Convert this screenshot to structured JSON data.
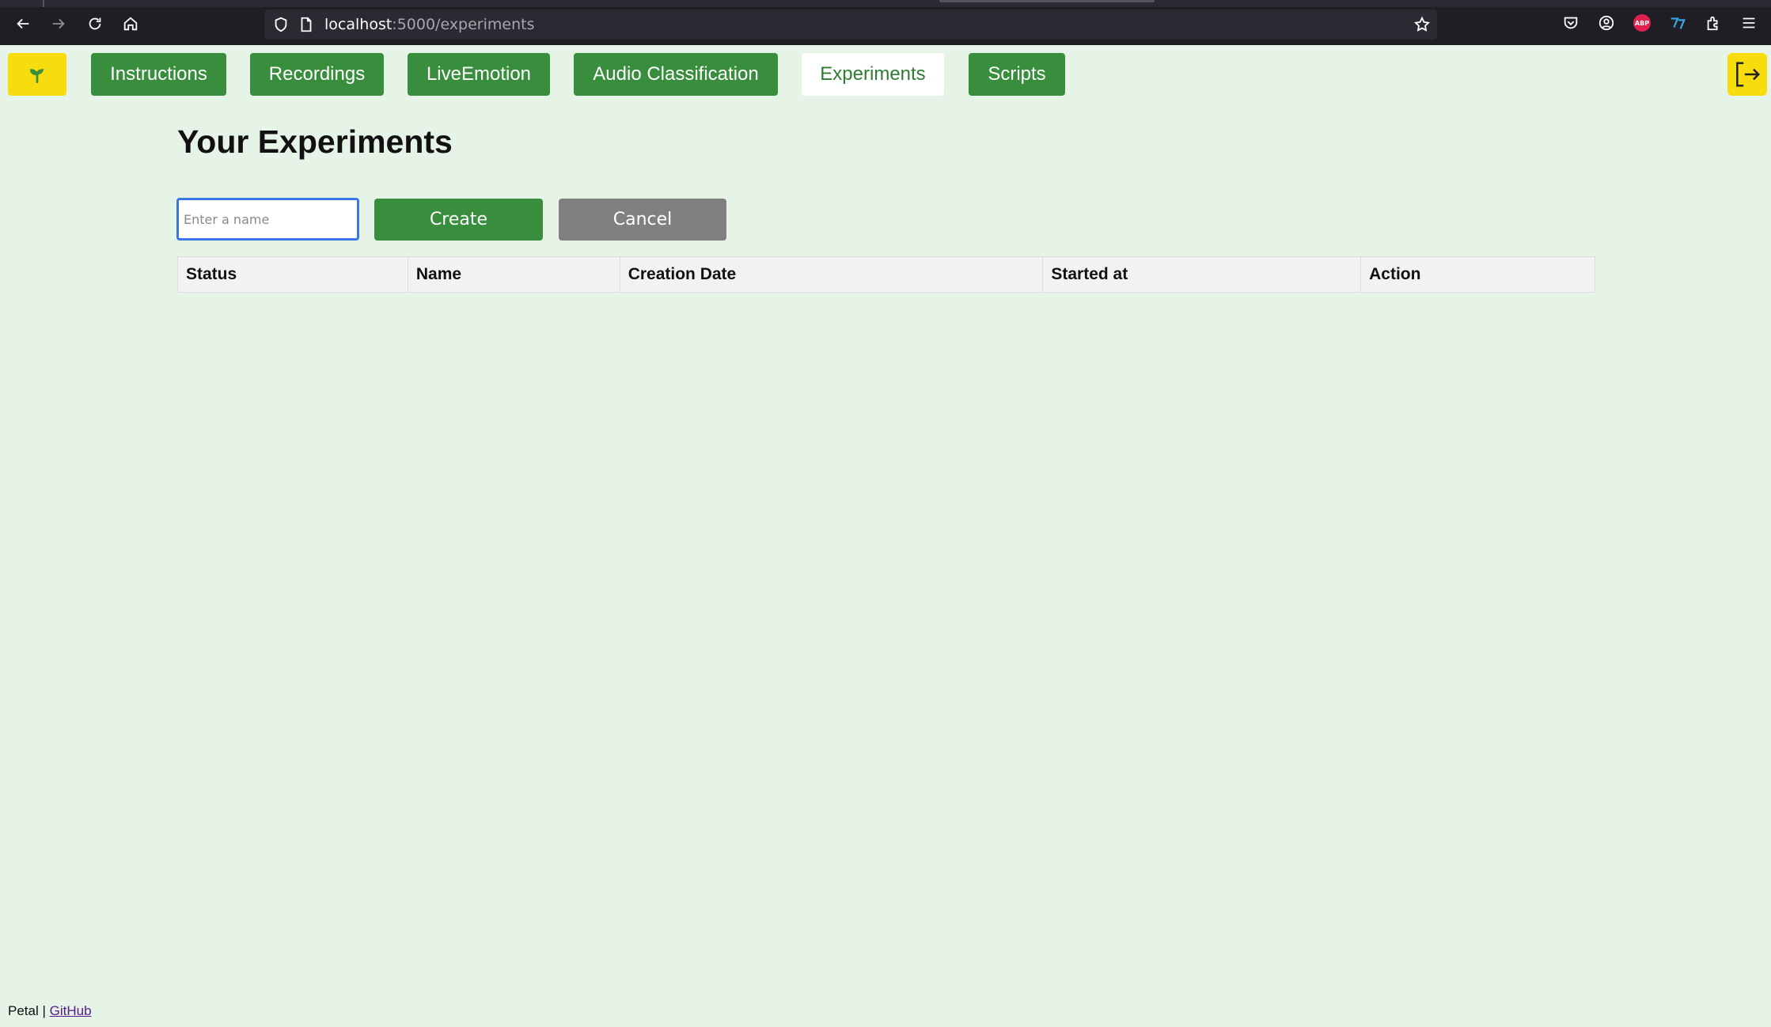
{
  "browser": {
    "url_host": "localhost",
    "url_path": ":5000/experiments",
    "icons": [
      "back-icon",
      "forward-icon",
      "reload-icon",
      "home-icon",
      "shield-icon",
      "page-icon",
      "bookmark-star-icon",
      "pocket-icon",
      "account-icon",
      "adblock-plus-icon",
      "translate-extension-icon",
      "extensions-icon",
      "menu-icon"
    ],
    "adblock_label": "ABP"
  },
  "nav": {
    "logo_icon": "sprout-icon",
    "items": [
      {
        "label": "Instructions"
      },
      {
        "label": "Recordings"
      },
      {
        "label": "LiveEmotion"
      },
      {
        "label": "Audio Classification"
      },
      {
        "label": "Experiments",
        "active": true
      },
      {
        "label": "Scripts"
      }
    ],
    "logout_icon": "logout-icon"
  },
  "main": {
    "title": "Your Experiments",
    "name_input": {
      "value": "",
      "placeholder": "Enter a name"
    },
    "create_label": "Create",
    "cancel_label": "Cancel",
    "table": {
      "columns": [
        "Status",
        "Name",
        "Creation Date",
        "Started at",
        "Action"
      ],
      "rows": []
    }
  },
  "footer": {
    "brand": "Petal",
    "separator": " | ",
    "link_label": "GitHub"
  },
  "colors": {
    "background": "#e6f4e7",
    "primary_green": "#388e3c",
    "accent_yellow": "#f7dd0e",
    "cancel_gray": "#808080"
  }
}
